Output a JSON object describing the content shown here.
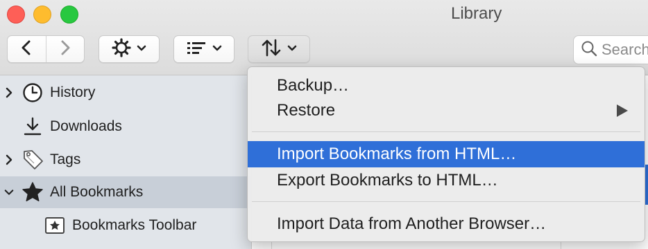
{
  "window": {
    "title": "Library"
  },
  "toolbar": {
    "back_icon": "chevron-left-icon",
    "forward_icon": "chevron-right-icon",
    "organize_icon": "gear-icon",
    "views_icon": "list-icon",
    "import_export_icon": "up-down-arrows-icon",
    "search_placeholder": "Search"
  },
  "sidebar": {
    "items": [
      {
        "label": "History",
        "icon": "clock-icon",
        "expandable": true,
        "selected": false
      },
      {
        "label": "Downloads",
        "icon": "download-icon",
        "expandable": false,
        "selected": false
      },
      {
        "label": "Tags",
        "icon": "tag-icon",
        "expandable": true,
        "selected": false
      },
      {
        "label": "All Bookmarks",
        "icon": "star-icon",
        "expandable": true,
        "selected": true,
        "expanded": true
      },
      {
        "label": "Bookmarks Toolbar",
        "icon": "bookmark-toolbar-icon",
        "expandable": false,
        "selected": false
      }
    ]
  },
  "menu": {
    "items": [
      {
        "label": "Backup…",
        "highlighted": false
      },
      {
        "label": "Restore",
        "submenu": true,
        "highlighted": false
      },
      {
        "label": "Import Bookmarks from HTML…",
        "highlighted": true
      },
      {
        "label": "Export Bookmarks to HTML…",
        "highlighted": false
      },
      {
        "label": "Import Data from Another Browser…",
        "highlighted": false
      }
    ]
  },
  "colors": {
    "highlight": "#2f6fd8",
    "sidebar_selected": "#c8cfd8",
    "sidebar_bg": "#e1e5ea"
  }
}
